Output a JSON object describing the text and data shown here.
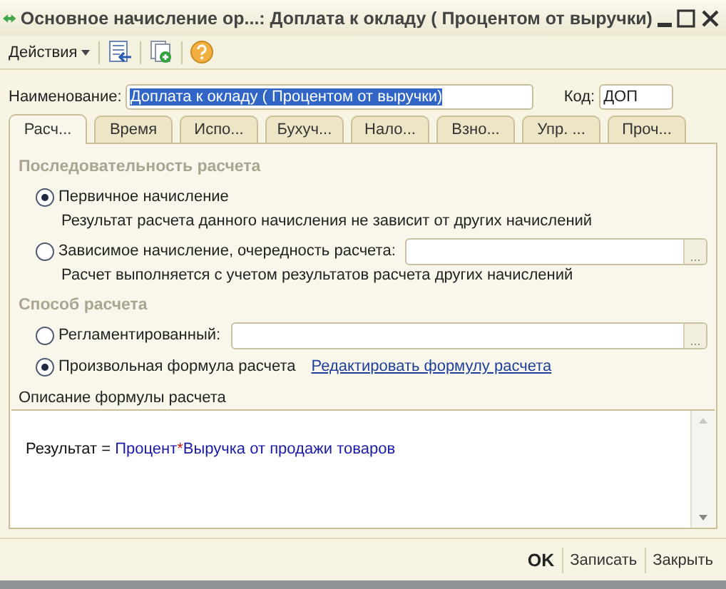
{
  "window": {
    "title": "Основное начисление ор...: Доплата к окладу ( Процентом от выручки)"
  },
  "toolbar": {
    "actions_label": "Действия"
  },
  "name_field": {
    "label": "Наименование:",
    "value": "Доплата к окладу ( Процентом от выручки)",
    "selected": true
  },
  "code_field": {
    "label": "Код:",
    "value": "ДОП"
  },
  "tabs": [
    {
      "label": "Расч...",
      "selected": true
    },
    {
      "label": "Время",
      "selected": false
    },
    {
      "label": "Испо...",
      "selected": false
    },
    {
      "label": "Бухуч...",
      "selected": false
    },
    {
      "label": "Нало...",
      "selected": false
    },
    {
      "label": "Взно...",
      "selected": false
    },
    {
      "label": "Упр. ...",
      "selected": false
    },
    {
      "label": "Проч...",
      "selected": false
    }
  ],
  "sections": [
    {
      "title": "Последовательность расчета",
      "options": [
        {
          "label": "Первичное начисление",
          "selected": true,
          "description": "Результат расчета данного начисления не зависит от других начислений"
        },
        {
          "label": "Зависимое начисление, очередность расчета:",
          "selected": false,
          "has_field": true,
          "field_button": "...",
          "description": "Расчет выполняется с учетом результатов расчета других начислений"
        }
      ]
    },
    {
      "title": "Способ расчета",
      "options": [
        {
          "label": "Регламентированный:",
          "selected": false,
          "has_field": true,
          "field_button": "..."
        },
        {
          "label": "Произвольная формула расчета",
          "selected": true,
          "link": "Редактировать формулу расчета"
        }
      ]
    }
  ],
  "formula_description": {
    "label": "Описание формулы расчета",
    "parts": [
      {
        "text": "Результат = ",
        "kind": "plain"
      },
      {
        "text": "Процент",
        "kind": "operand"
      },
      {
        "text": "*",
        "kind": "operator"
      },
      {
        "text": "Выручка от продажи товаров",
        "kind": "operand"
      }
    ]
  },
  "footer_buttons": [
    {
      "label": "OK",
      "kind": "default"
    },
    {
      "label": "Записать",
      "kind": "normal"
    },
    {
      "label": "Закрыть",
      "kind": "normal"
    }
  ]
}
